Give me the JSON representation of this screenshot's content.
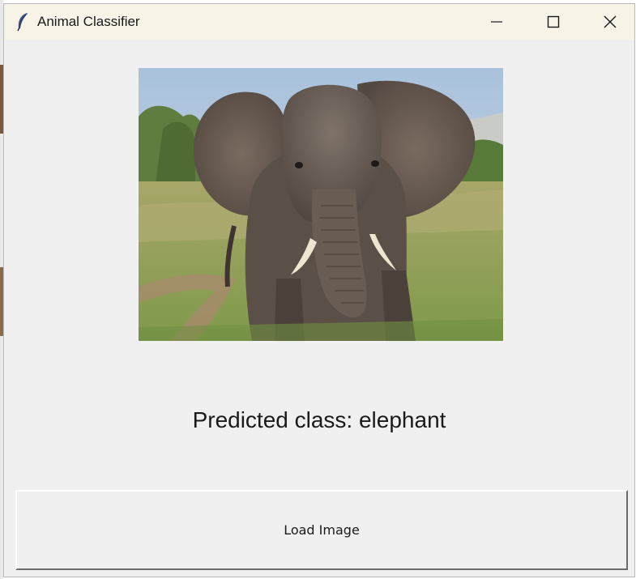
{
  "window": {
    "title": "Animal Classifier",
    "icon": "feather-icon",
    "controls": [
      "minimize-icon",
      "maximize-icon",
      "close-icon"
    ]
  },
  "image": {
    "subject": "elephant-photo"
  },
  "prediction": {
    "text": "Predicted class: elephant"
  },
  "actions": {
    "load_label": "Load Image"
  },
  "colors": {
    "titlebar": "#f7f3e6",
    "window_bg": "#f0f0f0"
  }
}
